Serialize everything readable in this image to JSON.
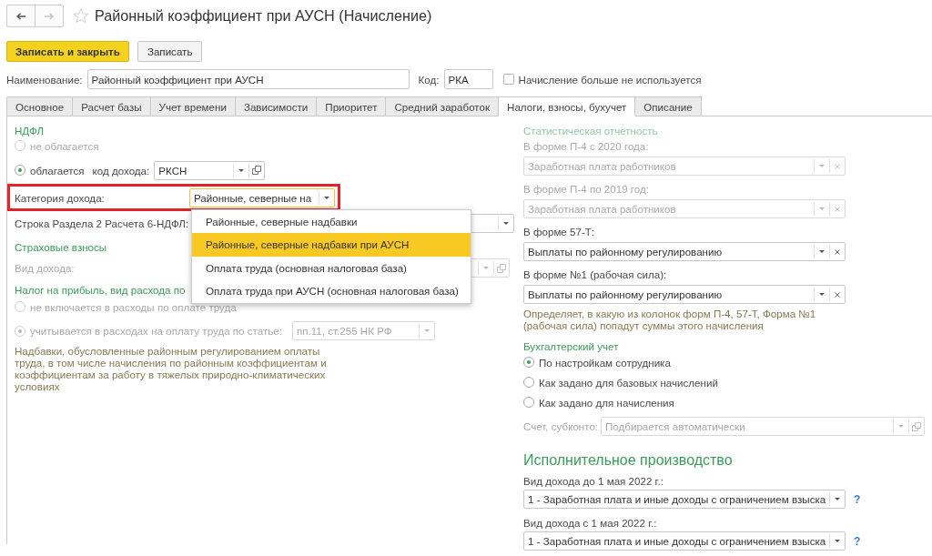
{
  "nav": {
    "back": {
      "disabled": false
    },
    "forward": {
      "disabled": true
    }
  },
  "window": {
    "title": "Районный коэффициент при АУСН (Начисление)",
    "favorite": false
  },
  "toolbar": {
    "buttons": [
      {
        "label": "Записать и закрыть",
        "kind": "primary"
      },
      {
        "label": "Записать",
        "kind": "default"
      }
    ]
  },
  "header": {
    "name": {
      "label": "Наименование:",
      "value": "Районный коэффициент при АУСН"
    },
    "code": {
      "label": "Код:",
      "value": "РКА"
    },
    "not_used": {
      "label": "Начисление больше не используется",
      "checked": false
    }
  },
  "tabs": [
    {
      "label": "Основное",
      "selected": false
    },
    {
      "label": "Расчет базы",
      "selected": false
    },
    {
      "label": "Учет времени",
      "selected": false
    },
    {
      "label": "Зависимости",
      "selected": false
    },
    {
      "label": "Приоритет",
      "selected": false
    },
    {
      "label": "Средний заработок",
      "selected": false
    },
    {
      "label": "Налоги, взносы, бухучет",
      "selected": true
    },
    {
      "label": "Описание",
      "selected": false
    }
  ],
  "left": {
    "ndfl": {
      "heading": "НДФЛ",
      "not_taxed": {
        "label": "не облагается",
        "selected": false,
        "disabled": true
      },
      "taxed": {
        "label": "облагается",
        "selected": true,
        "disabled": false
      },
      "income_code": {
        "label": "код дохода:",
        "value": "РКСН",
        "kind": "select-open"
      },
      "income_category": {
        "label": "Категория дохода:",
        "value": "Районные, северные на",
        "kind": "select",
        "focused": true,
        "highlighted": true,
        "expanded": true,
        "options": [
          {
            "label": "Районные, северные надбавки",
            "selected": false
          },
          {
            "label": "Районные, северные надбавки при АУСН",
            "selected": true
          },
          {
            "label": "Оплата труда (основная налоговая база)",
            "selected": false
          },
          {
            "label": "Оплата труда при АУСН (основная налоговая база)",
            "selected": false
          }
        ]
      },
      "report_line": {
        "label": "Строка Раздела 2 Расчета 6-НДФЛ:",
        "kind": "select"
      }
    },
    "insurance": {
      "heading": "Страховые взносы",
      "income_type": {
        "label": "Вид дохода:",
        "kind": "select-open",
        "disabled": true
      }
    },
    "profit_tax": {
      "heading": "Налог на прибыль, вид расхода по",
      "options": [
        {
          "label": "не включается в расходы по оплате труда",
          "selected": false,
          "disabled": true
        },
        {
          "label": "учитывается в расходах на оплату труда по статье:",
          "selected": true,
          "disabled": true
        }
      ],
      "article": {
        "value": "пп.11, ст.255 НК РФ",
        "kind": "select",
        "disabled": true
      }
    },
    "note": "Надбавки, обусловленные районным регулированием оплаты труда, в том числе начисления по районным коэффициентам и коэффициентам за работу в тяжелых природно-климатических условиях"
  },
  "right": {
    "statistics": {
      "heading": "Статистическая отчетность",
      "heading_disabled": true,
      "fields": [
        {
          "label": "В форме П-4 с 2020 года:",
          "value": "Заработная плата работников",
          "kind": "select-clear",
          "disabled": true
        },
        {
          "label": "В форме П-4 по 2019 год:",
          "value": "Заработная плата работников",
          "kind": "select-clear",
          "disabled": true
        },
        {
          "label": "В форме 57-Т:",
          "value": "Выплаты по районному регулированию",
          "kind": "select-clear",
          "disabled": false
        },
        {
          "label": "В форме №1 (рабочая сила):",
          "value": "Выплаты по районному регулированию",
          "kind": "select-clear",
          "disabled": false
        }
      ],
      "note": "Определяет, в какую из колонок форм П-4, 57-Т, Форма №1 (рабочая сила) попадут суммы этого начисления"
    },
    "accounting": {
      "heading": "Бухгалтерский учет",
      "options": [
        {
          "label": "По настройкам сотрудника",
          "selected": true
        },
        {
          "label": "Как задано для базовых начислений",
          "selected": false
        },
        {
          "label": "Как задано для начисления",
          "selected": false
        }
      ],
      "account": {
        "label": "Счет, субконто:",
        "placeholder": "Подбирается автоматически",
        "kind": "select-open",
        "disabled": true
      }
    },
    "enforcement": {
      "heading": "Исполнительное производство",
      "fields": [
        {
          "label": "Вид дохода до 1 мая 2022 г.:",
          "value": "1 - Заработная плата и иные доходы с ограничением взыска",
          "kind": "select",
          "help": "?"
        },
        {
          "label": "Вид дохода с 1 мая 2022 г.:",
          "value": "1 - Заработная плата и иные доходы с ограничением взыска",
          "kind": "select",
          "help": "?"
        }
      ]
    }
  }
}
